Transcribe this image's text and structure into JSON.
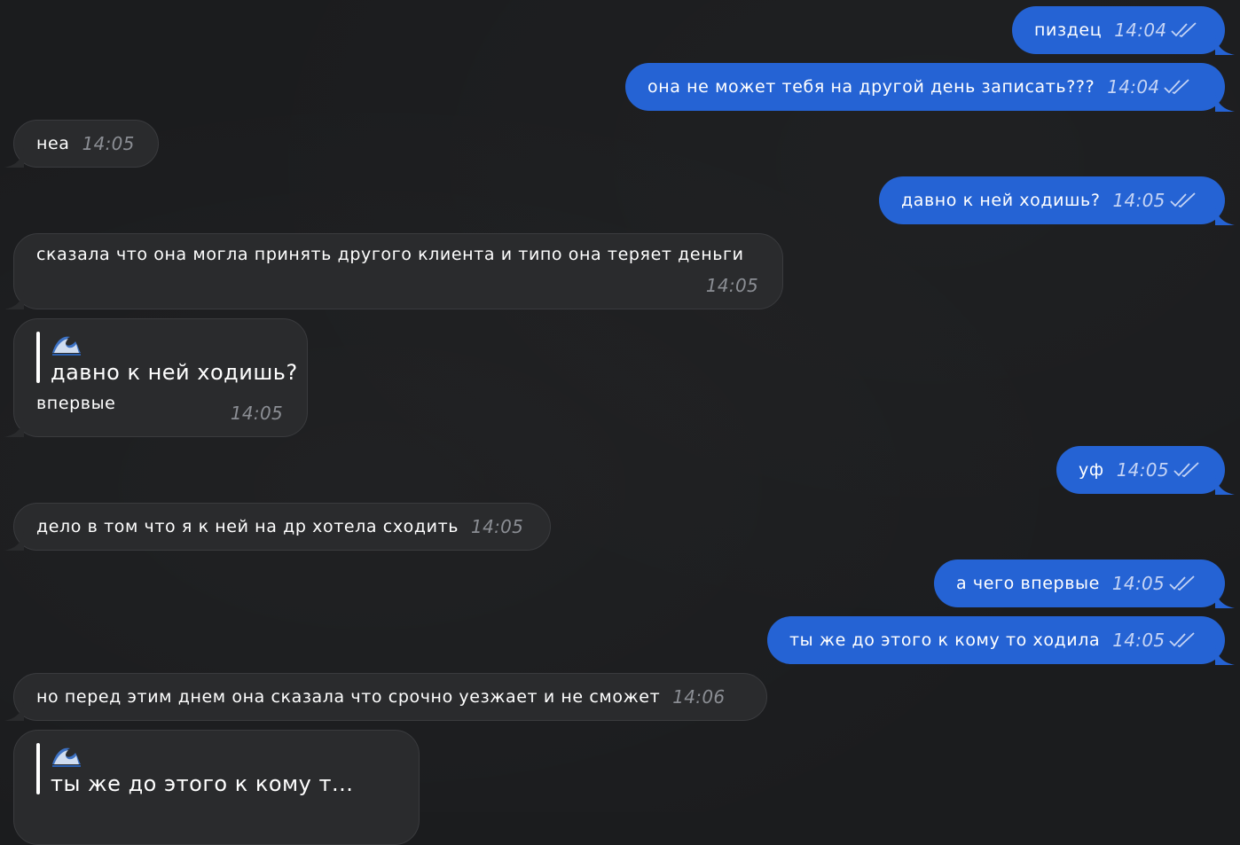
{
  "messages": [
    {
      "id": "m1",
      "side": "out",
      "text": "пиздец",
      "time": "14:04"
    },
    {
      "id": "m2",
      "side": "out",
      "text": "она не может тебя на другой день записать???",
      "time": "14:04"
    },
    {
      "id": "m3",
      "side": "in",
      "text": "неа",
      "time": "14:05"
    },
    {
      "id": "m4",
      "side": "out",
      "text": "давно к ней ходишь?",
      "time": "14:05"
    },
    {
      "id": "m5",
      "side": "in",
      "text": "сказала что она могла принять другого клиента и типо она теряет деньги",
      "time": "14:05"
    },
    {
      "id": "m6",
      "side": "in",
      "reply_quote": "давно к ней ходишь?",
      "reply_icon": "wave-emoji-icon",
      "text": "впервые",
      "time": "14:05"
    },
    {
      "id": "m7",
      "side": "out",
      "text": "уф",
      "time": "14:05"
    },
    {
      "id": "m8",
      "side": "in",
      "text": "дело в том что я к ней на др хотела сходить",
      "time": "14:05"
    },
    {
      "id": "m9",
      "side": "out",
      "text": "а чего впервые",
      "time": "14:05"
    },
    {
      "id": "m10",
      "side": "out",
      "text": "ты же до этого к кому то ходила",
      "time": "14:05"
    },
    {
      "id": "m11",
      "side": "in",
      "text": "но перед этим днем она сказала что срочно уезжает и не сможет",
      "time": "14:06"
    },
    {
      "id": "m12",
      "side": "in",
      "reply_quote": "ты же до этого к кому т...",
      "reply_icon": "wave-emoji-icon",
      "text": "",
      "time": ""
    }
  ],
  "colors": {
    "background": "#1b1c1e",
    "incoming_bubble": "#2a2b2d",
    "outgoing_bubble": "#2563d4",
    "time_incoming": "#8b8e94",
    "time_outgoing": "#c5d4f5"
  },
  "icons": {
    "read_receipt": "double-check-icon",
    "reply_avatar": "wave-emoji-icon"
  }
}
